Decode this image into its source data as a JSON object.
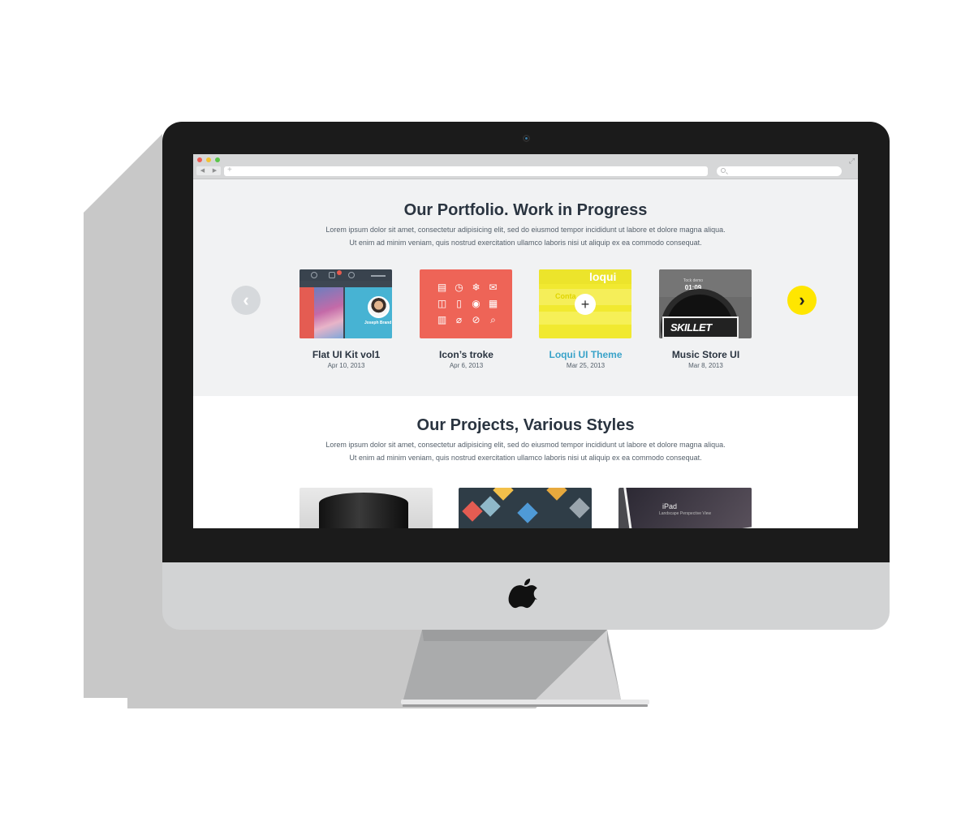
{
  "browser": {
    "nav_back": "◀",
    "nav_forward": "▶",
    "url_plus": "+",
    "expand": "⤢"
  },
  "portfolio": {
    "title": "Our Portfolio. Work in Progress",
    "text_line1": "Lorem ipsum dolor sit amet, consectetur adipisicing elit, sed do eiusmod tempor incididunt ut labore et dolore magna aliqua.",
    "text_line2": "Ut enim ad minim veniam, quis nostrud exercitation ullamco laboris nisi ut aliquip ex ea commodo consequat.",
    "prev_arrow": "‹",
    "next_arrow": "›",
    "items": [
      {
        "title": "Flat UI Kit vol1",
        "date": "Apr 10, 2013",
        "thumb_name": "Joseph Brand"
      },
      {
        "title": "Icon’s troke",
        "date": "Apr 6, 2013"
      },
      {
        "title": "Loqui UI Theme",
        "date": "Mar 25, 2013",
        "thumb_logo": "loqui",
        "thumb_row": "Conta",
        "thumb_plus": "+"
      },
      {
        "title": "Music Store UI",
        "date": "Mar 8, 2013",
        "thumb_caption": "Tock demo",
        "thumb_time": "01:09",
        "thumb_band": "SKILLET"
      }
    ],
    "colors": {
      "active_title": "#3aa3c9",
      "next_button": "#ffe600",
      "prev_button": "#d6d9dc"
    }
  },
  "projects": {
    "title": "Our Projects, Various Styles",
    "text_line1": "Lorem ipsum dolor sit amet, consectetur adipisicing elit, sed do eiusmod tempor incididunt ut labore et dolore magna aliqua.",
    "text_line2": "Ut enim ad minim veniam, quis nostrud exercitation ullamco laboris nisi ut aliquip ex ea commodo consequat.",
    "items": [
      {
        "icon": "coffee-cup-image"
      },
      {
        "icon": "flat-icons-image"
      },
      {
        "icon": "ipad-mockup-image",
        "label": "iPad",
        "sub": "Landscape Perspective View"
      }
    ]
  },
  "icons": {
    "monitor": "apple-logo-icon",
    "thumb2_glyphs": [
      "▤",
      "◷",
      "❄",
      "✉",
      "◫",
      "▯",
      "◉",
      "▦",
      "▥",
      "⌀",
      "⊘",
      "⌕"
    ]
  }
}
